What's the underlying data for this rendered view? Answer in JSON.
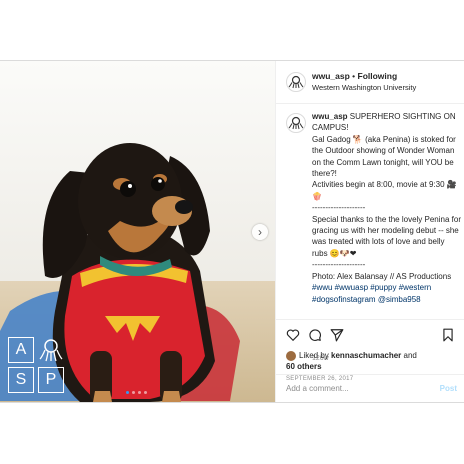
{
  "header": {
    "username": "wwu_asp",
    "separator": " • ",
    "follow_label": "Following",
    "location": "Western Washington University"
  },
  "caption": {
    "username": "wwu_asp",
    "body": " SUPERHERO SIGHTING ON CAMPUS!\nGal Gadog 🐕 (aka Penina) is stoked for the Outdoor showing of Wonder Woman on the Comm Lawn tonight, will YOU be there?!\nActivities begin at 8:00, movie at 9:30 🎥🍿\n--------------------\nSpecial thanks to the the lovely Penina for gracing us with her modeling debut -- she was treated with lots of love and belly rubs 😊🐶❤\n--------------------\nPhoto: Alex Balansay // AS Productions\n",
    "hashtags": "#wwu #wwuasp #puppy #western #dogsofinstagram @simba958",
    "time_ago": "126w"
  },
  "actions": {
    "icons": [
      "heart-icon",
      "comment-icon",
      "share-icon",
      "bookmark-icon"
    ]
  },
  "likes": {
    "prefix": "Liked by ",
    "liker": "kennaschumacher",
    "middle": " and",
    "others": "60 others"
  },
  "post_date": "SEPTEMBER 26, 2017",
  "comment_box": {
    "placeholder": "Add a comment...",
    "post_label": "Post"
  },
  "photo": {
    "logo_letters": [
      "A",
      "S",
      "P"
    ],
    "carousel_total": 4,
    "carousel_active": 1,
    "accent": "#3897f0"
  }
}
